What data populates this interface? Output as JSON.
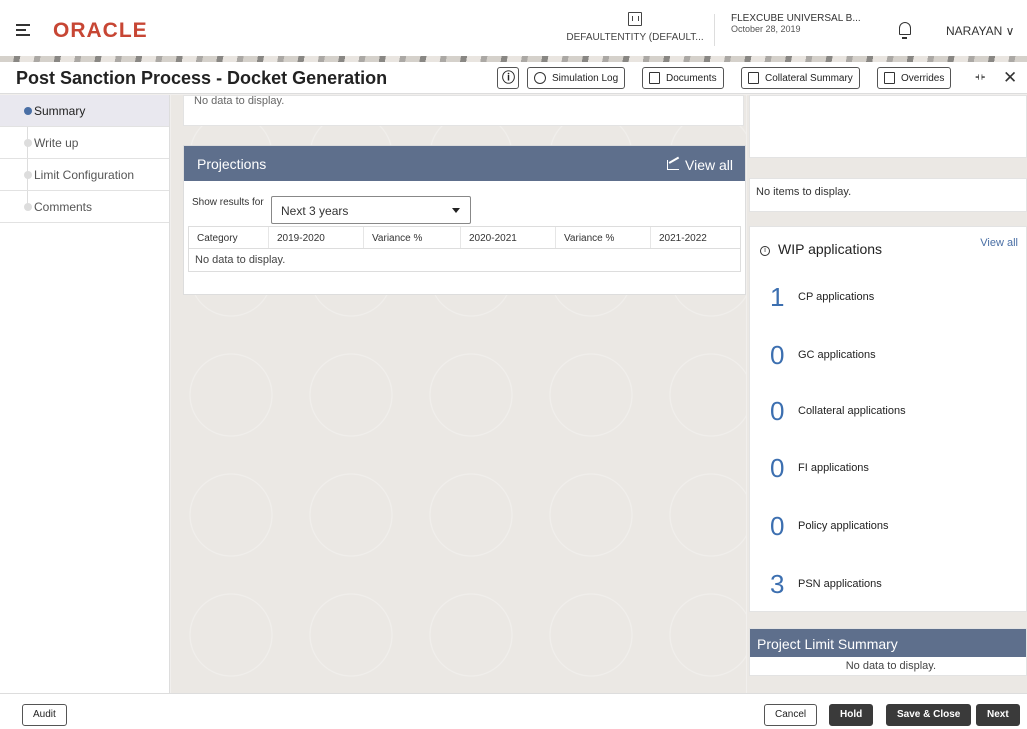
{
  "header": {
    "logo": "ORACLE",
    "entity": "DEFAULTENTITY (DEFAULT...",
    "app_name": "FLEXCUBE UNIVERSAL B...",
    "app_date": "October 28, 2019",
    "user": "NARAYAN ∨"
  },
  "titlebar": {
    "title": "Post Sanction Process - Docket Generation",
    "info_icon": "ⓘ",
    "simulation_log": "Simulation Log",
    "documents": "Documents",
    "collateral_summary": "Collateral Summary",
    "overrides": "Overrides",
    "close": "✕"
  },
  "nav": {
    "items": [
      {
        "label": "Summary"
      },
      {
        "label": "Write up"
      },
      {
        "label": "Limit Configuration"
      },
      {
        "label": "Comments"
      }
    ]
  },
  "main": {
    "top_card_text": "No data to display.",
    "projections": {
      "title": "Projections",
      "view_all": "View all",
      "show_results_label": "Show results for",
      "select_value": "Next 3 years",
      "columns": [
        "Category",
        "2019-2020",
        "Variance %",
        "2020-2021",
        "Variance %",
        "2021-2022"
      ],
      "empty": "No data to display."
    }
  },
  "right": {
    "items_empty": "No items to display.",
    "wip": {
      "title": "WIP applications",
      "view_all": "View all",
      "rows": [
        {
          "count": "1",
          "label": "CP applications"
        },
        {
          "count": "0",
          "label": "GC applications"
        },
        {
          "count": "0",
          "label": "Collateral applications"
        },
        {
          "count": "0",
          "label": "FI applications"
        },
        {
          "count": "0",
          "label": "Policy applications"
        },
        {
          "count": "3",
          "label": "PSN applications"
        }
      ]
    },
    "project_limit": {
      "title": "Project Limit Summary",
      "empty": "No data to display."
    }
  },
  "footer": {
    "audit": "Audit",
    "cancel": "Cancel",
    "hold": "Hold",
    "save_close": "Save & Close",
    "next": "Next"
  }
}
